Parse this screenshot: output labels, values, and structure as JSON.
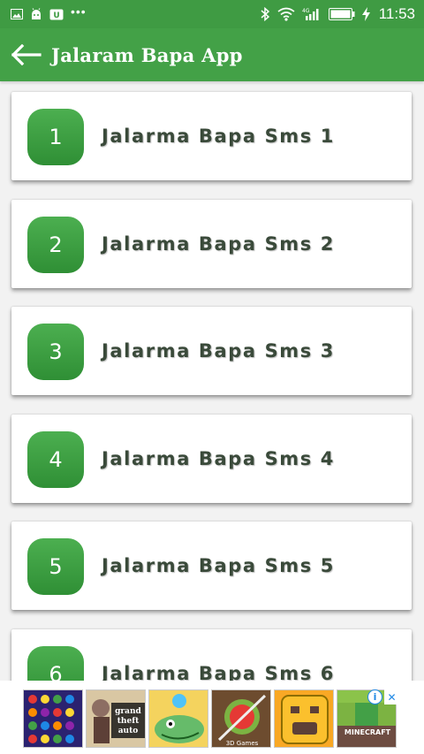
{
  "status_bar": {
    "time": "11:53",
    "left_icons": [
      "image-icon",
      "android-icon",
      "calendar-icon",
      "more-dots-icon"
    ],
    "right_icons": [
      "bluetooth-icon",
      "wifi-icon",
      "signal-4g-icon",
      "battery-icon",
      "charging-icon"
    ],
    "signal_label": "4G"
  },
  "app_bar": {
    "title": "Jalaram Bapa App",
    "color": "#43a147"
  },
  "list": {
    "items": [
      {
        "number": "1",
        "label": "Jalarma Bapa Sms 1"
      },
      {
        "number": "2",
        "label": "Jalarma Bapa Sms 2"
      },
      {
        "number": "3",
        "label": "Jalarma Bapa Sms 3"
      },
      {
        "number": "4",
        "label": "Jalarma Bapa Sms 4"
      },
      {
        "number": "5",
        "label": "Jalarma Bapa Sms 5"
      },
      {
        "number": "6",
        "label": "Jalarma Bapa Sms 6"
      }
    ]
  },
  "ad": {
    "tiles": [
      "candy-game-icon",
      "grand-theft-auto-icon",
      "crocodile-game-icon",
      "fruit-ninja-icon",
      "temple-run-icon",
      "minecraft-icon"
    ],
    "tile_texts": {
      "gta": "grand theft auto",
      "fruit": "3D Games",
      "minecraft": "MINECRAFT"
    },
    "info_label": "i",
    "close_label": "✕"
  }
}
